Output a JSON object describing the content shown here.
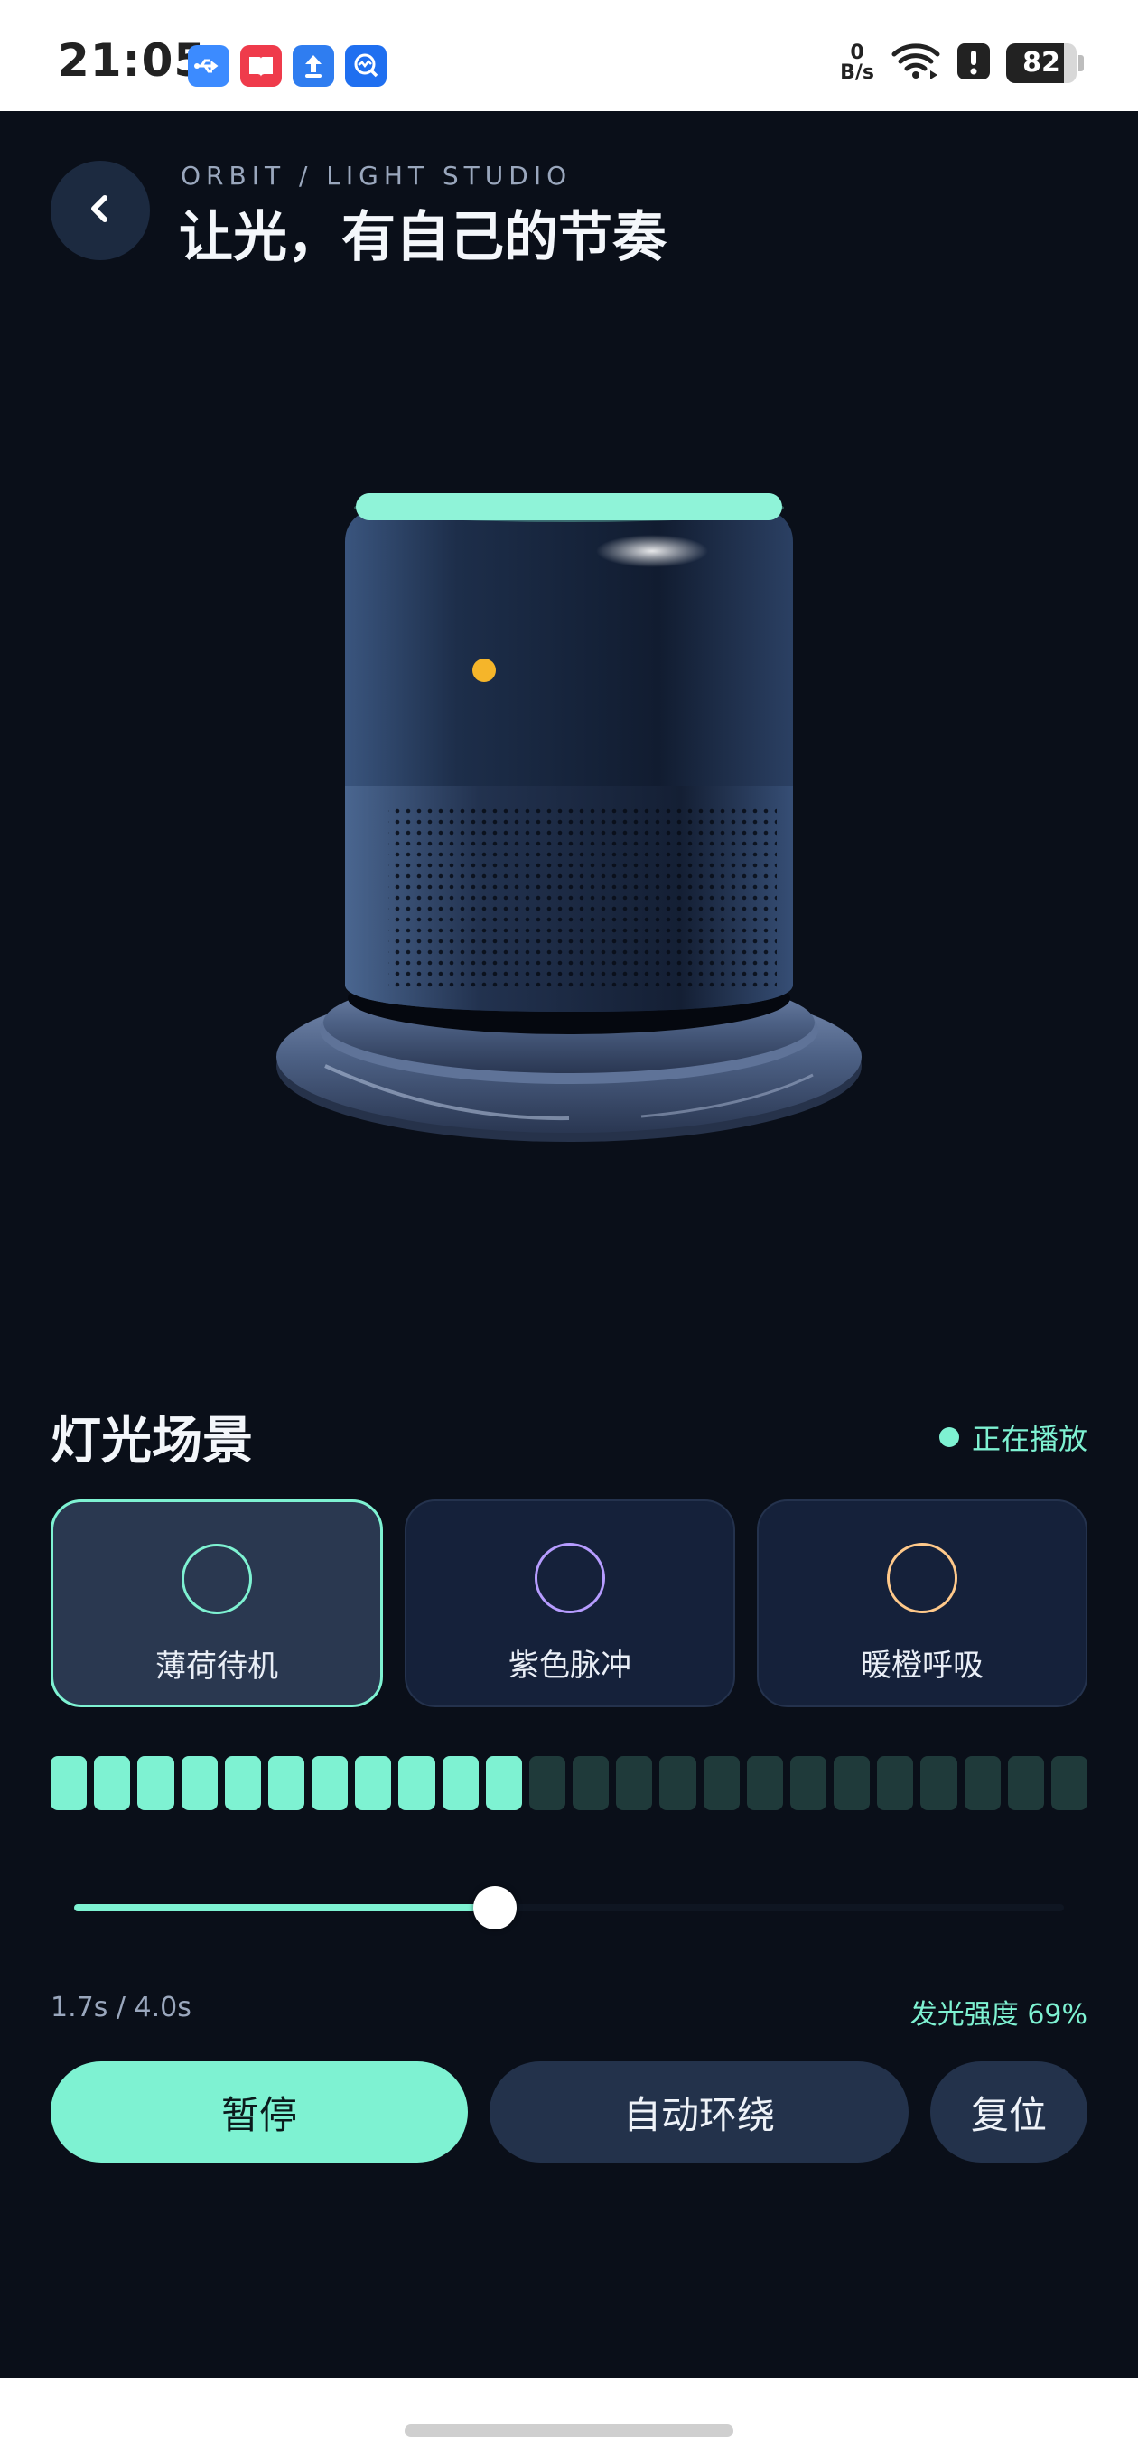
{
  "status_bar": {
    "time": "21:05",
    "net_speed_value": "0",
    "net_speed_unit": "B/s",
    "battery": "82",
    "battery_level": 0.82,
    "app_icons": [
      "usb-icon",
      "book-app-icon",
      "upload-app-icon",
      "monitor-app-icon"
    ],
    "status_icons": [
      "wifi-icon",
      "alert-icon",
      "battery-icon"
    ]
  },
  "header": {
    "back_icon": "chevron-left-icon",
    "subtitle": "ORBIT / LIGHT STUDIO",
    "title": "让光，有自己的节奏"
  },
  "scenes": {
    "title": "灯光场景",
    "status": "正在播放",
    "items": [
      {
        "label": "薄荷待机",
        "color": "#7ef2d2",
        "active": true
      },
      {
        "label": "紫色脉冲",
        "color": "#b69cff",
        "active": false
      },
      {
        "label": "暖橙呼吸",
        "color": "#ffc98a",
        "active": false
      }
    ]
  },
  "levels": {
    "total_segments": 24,
    "active_segments": 11
  },
  "progress": {
    "fraction": 0.425,
    "time_text": "1.7s / 4.0s",
    "intensity_text": "发光强度 69%"
  },
  "buttons": {
    "pause": "暂停",
    "auto": "自动环绕",
    "reset": "复位"
  },
  "colors": {
    "accent": "#7ef2d2",
    "background": "#0a0f19",
    "card": "#15213a"
  }
}
